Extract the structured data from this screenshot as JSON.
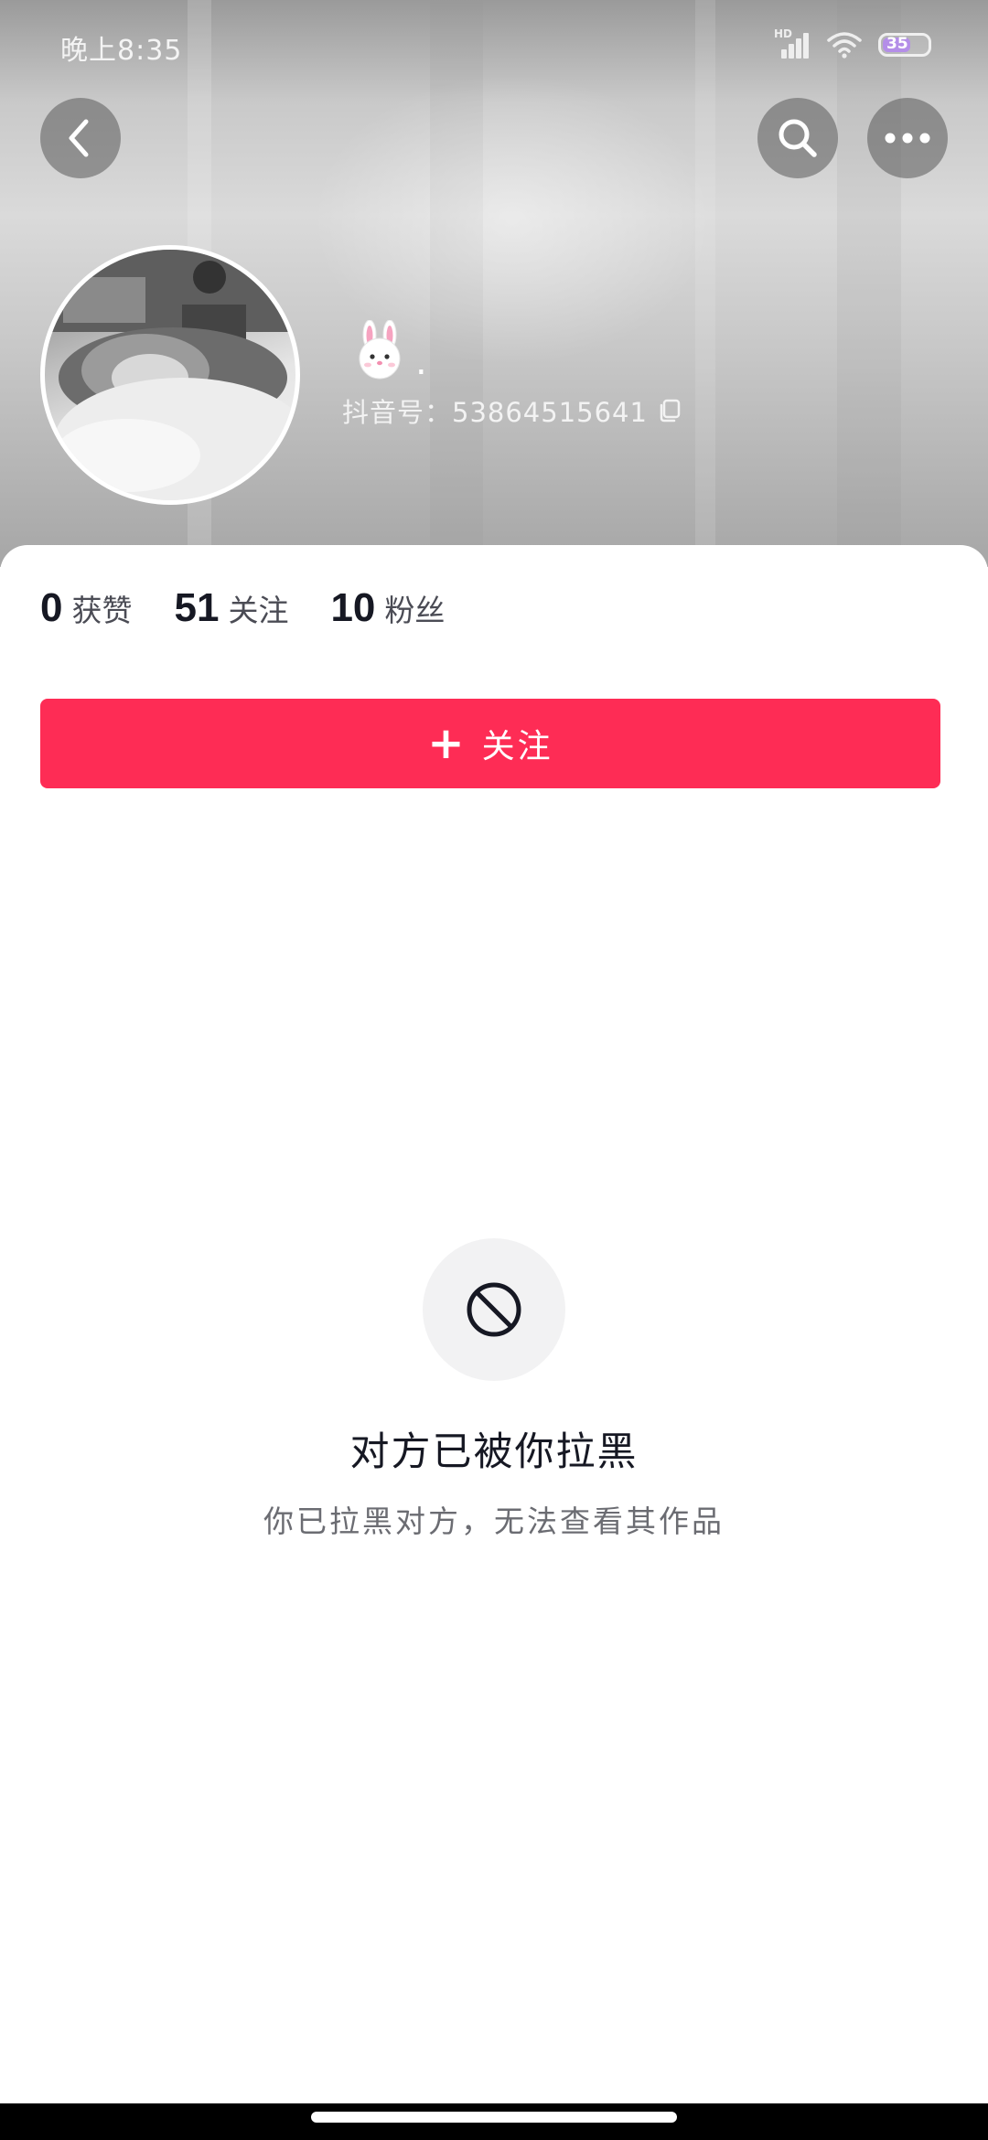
{
  "status_bar": {
    "time": "晚上8:35",
    "network": "HD",
    "battery": "35"
  },
  "profile": {
    "nickname_emoji": "🐰",
    "nickname_suffix": ".",
    "douyin_id": "抖音号：53864515641",
    "stats": [
      {
        "num": "0",
        "label": "获赞"
      },
      {
        "num": "51",
        "label": "关注"
      },
      {
        "num": "10",
        "label": "粉丝"
      }
    ]
  },
  "actions": {
    "follow_plus": "+",
    "follow_label": "关注"
  },
  "blocked": {
    "title": "对方已被你拉黑",
    "subtitle": "你已拉黑对方，无法查看其作品"
  },
  "icons": {
    "back": "chevron-left-icon",
    "search": "search-icon",
    "more": "more-icon",
    "copy": "copy-icon",
    "blocked": "prohibited-icon"
  },
  "colors": {
    "accent": "#fe2c55",
    "text_primary": "#161823",
    "text_secondary": "#6b6c72"
  }
}
